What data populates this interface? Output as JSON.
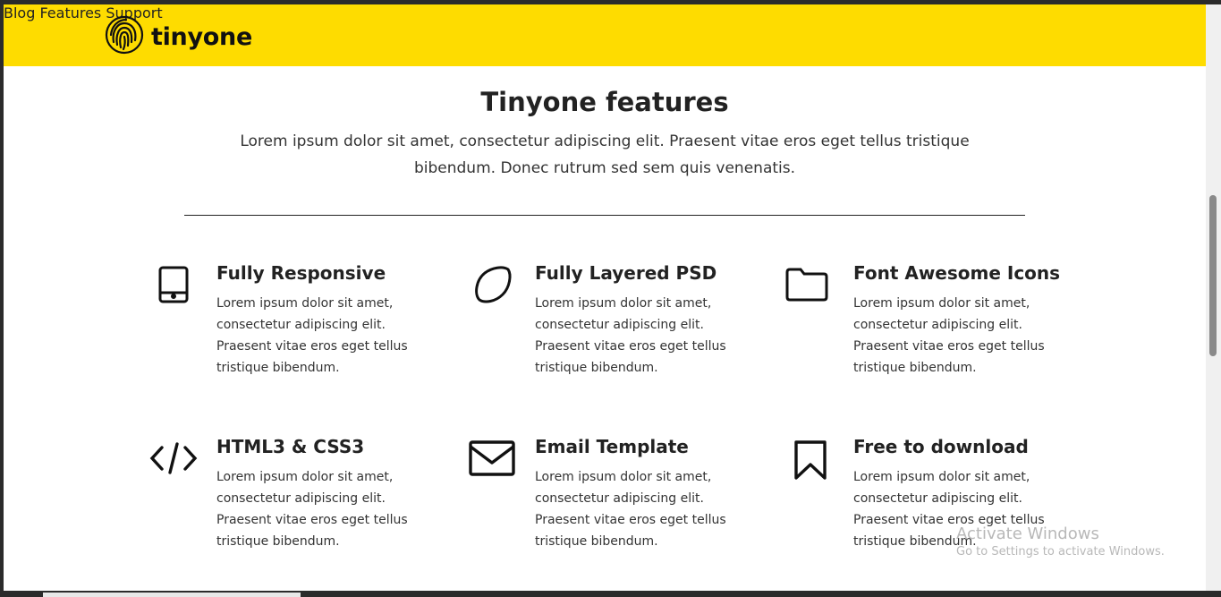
{
  "brand": {
    "name": "tinyone",
    "icon": "fingerprint-icon",
    "color": "#fedc00"
  },
  "nav": [
    {
      "label": "Blog"
    },
    {
      "label": "Features"
    },
    {
      "label": "Support"
    }
  ],
  "hero": {
    "title": "Tinyone features",
    "subtitle": "Lorem ipsum dolor sit amet, consectetur adipiscing elit. Praesent vitae eros eget tellus tristique bibendum. Donec rutrum sed sem quis venenatis."
  },
  "features": [
    {
      "icon": "tablet-icon",
      "title": "Fully Responsive",
      "text": "Lorem ipsum dolor sit amet, consectetur adipiscing elit. Praesent vitae eros eget tellus tristique bibendum."
    },
    {
      "icon": "lemon-icon",
      "title": "Fully Layered PSD",
      "text": "Lorem ipsum dolor sit amet, consectetur adipiscing elit. Praesent vitae eros eget tellus tristique bibendum."
    },
    {
      "icon": "folder-icon",
      "title": "Font Awesome Icons",
      "text": "Lorem ipsum dolor sit amet, consectetur adipiscing elit. Praesent vitae eros eget tellus tristique bibendum."
    },
    {
      "icon": "code-icon",
      "title": "HTML3 & CSS3",
      "text": "Lorem ipsum dolor sit amet, consectetur adipiscing elit. Praesent vitae eros eget tellus tristique bibendum."
    },
    {
      "icon": "envelope-icon",
      "title": "Email Template",
      "text": "Lorem ipsum dolor sit amet, consectetur adipiscing elit. Praesent vitae eros eget tellus tristique bibendum."
    },
    {
      "icon": "bookmark-icon",
      "title": "Free to download",
      "text": "Lorem ipsum dolor sit amet, consectetur adipiscing elit. Praesent vitae eros eget tellus tristique bibendum."
    }
  ],
  "watermark": {
    "line1": "Activate Windows",
    "line2": "Go to Settings to activate Windows."
  }
}
